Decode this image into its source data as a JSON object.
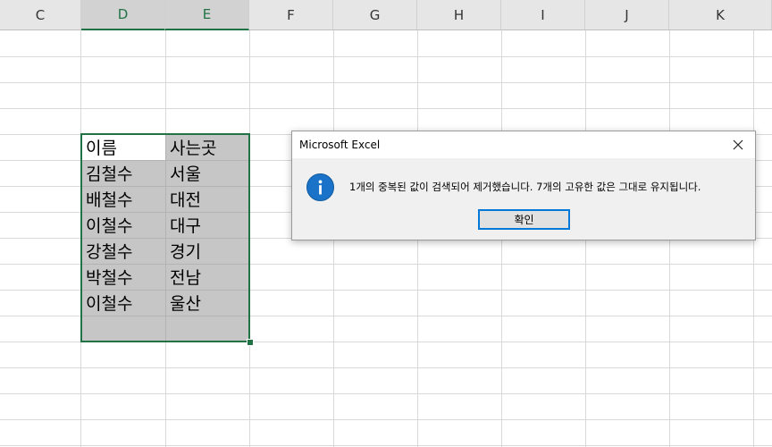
{
  "columns": [
    "C",
    "D",
    "E",
    "F",
    "G",
    "H",
    "I",
    "J",
    "K"
  ],
  "cells": {
    "D": [
      "이름",
      "김철수",
      "배철수",
      "이철수",
      "강철수",
      "박철수",
      "이철수"
    ],
    "E": [
      "사는곳",
      "서울",
      "대전",
      "대구",
      "경기",
      "전남",
      "울산"
    ]
  },
  "colors": {
    "accent": "#217346",
    "selection": "#c6c6c6",
    "info": "#1a73c8",
    "button_focus": "#0078d7"
  },
  "dialog": {
    "title": "Microsoft Excel",
    "message": "1개의 중복된 값이 검색되어 제거했습니다. 7개의 고유한 값은 그대로 유지됩니다.",
    "ok_label": "확인",
    "icon": "info-icon",
    "icon_glyph": "i",
    "close_glyph": "✕"
  }
}
